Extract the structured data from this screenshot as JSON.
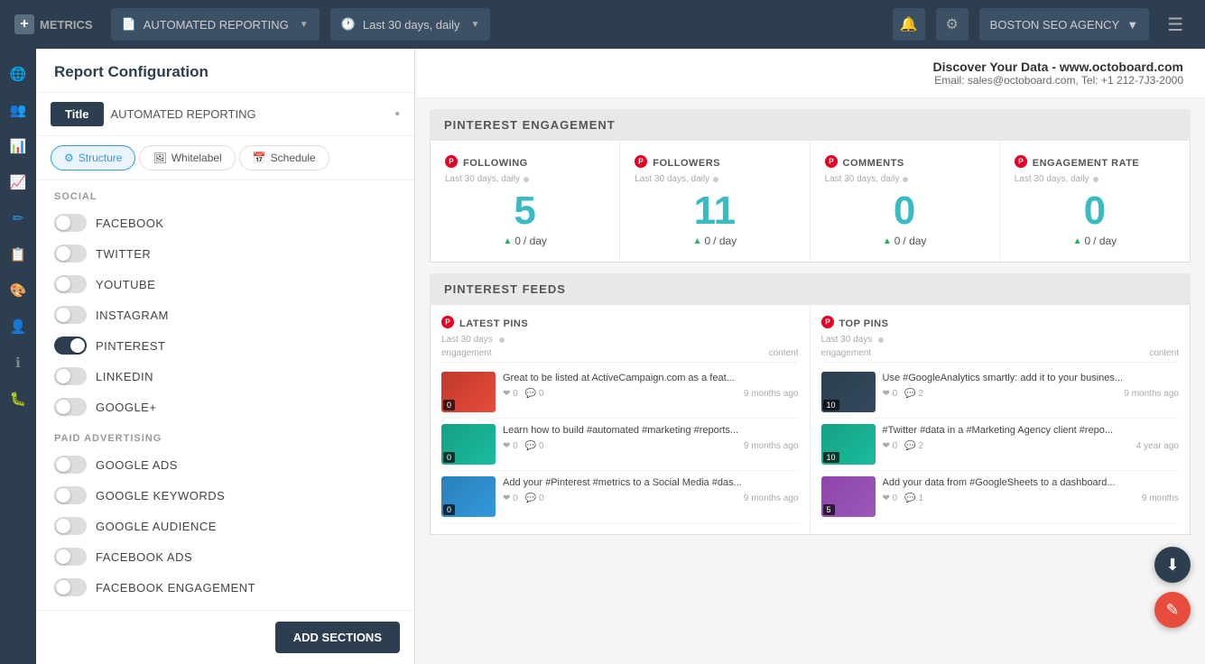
{
  "topNav": {
    "logoPlus": "+",
    "logoText": "METRICS",
    "reportingLabel": "AUTOMATED REPORTING",
    "dateRange": "Last 30 days, daily",
    "agency": "BOSTON SEO AGENCY",
    "icons": {
      "notifications": "🔔",
      "settings": "⚙",
      "arrow": "▼",
      "hamburger": "☰"
    }
  },
  "sideIcons": [
    {
      "name": "globe-icon",
      "symbol": "🌐",
      "active": true
    },
    {
      "name": "users-icon",
      "symbol": "👥",
      "active": false
    },
    {
      "name": "analytics-icon",
      "symbol": "📊",
      "active": false
    },
    {
      "name": "trending-icon",
      "symbol": "📈",
      "active": false
    },
    {
      "name": "edit-icon",
      "symbol": "✏",
      "active": true
    },
    {
      "name": "clipboard-icon",
      "symbol": "📋",
      "active": false
    },
    {
      "name": "paint-icon",
      "symbol": "🎨",
      "active": false
    },
    {
      "name": "user-icon",
      "symbol": "👤",
      "active": false
    },
    {
      "name": "info-icon",
      "symbol": "ℹ",
      "active": false
    },
    {
      "name": "bug-icon",
      "symbol": "🐛",
      "active": false
    }
  ],
  "configPanel": {
    "heading": "Report Configuration",
    "titleLabel": "Title",
    "titleValue": "AUTOMATED REPORTING",
    "tabs": [
      {
        "label": "Structure",
        "icon": "⚙",
        "active": true
      },
      {
        "label": "Whitelabel",
        "icon": "🖼",
        "active": false
      },
      {
        "label": "Schedule",
        "icon": "📅",
        "active": false
      }
    ],
    "social": {
      "sectionLabel": "SOCIAL",
      "items": [
        {
          "label": "FACEBOOK",
          "on": false
        },
        {
          "label": "TWITTER",
          "on": false
        },
        {
          "label": "YOUTUBE",
          "on": false
        },
        {
          "label": "INSTAGRAM",
          "on": false
        },
        {
          "label": "PINTEREST",
          "on": true
        },
        {
          "label": "LINKEDIN",
          "on": false
        },
        {
          "label": "GOOGLE+",
          "on": false
        }
      ]
    },
    "paidAdvertising": {
      "sectionLabel": "PAID ADVERTISING",
      "items": [
        {
          "label": "GOOGLE ADS",
          "on": false
        },
        {
          "label": "GOOGLE KEYWORDS",
          "on": false
        },
        {
          "label": "GOOGLE AUDIENCE",
          "on": false
        },
        {
          "label": "FACEBOOK ADS",
          "on": false
        },
        {
          "label": "FACEBOOK ENGAGEMENT",
          "on": false
        }
      ]
    },
    "addSectionsBtn": "ADD SECTIONS"
  },
  "reportHeader": {
    "title": "Discover Your Data - www.octoboard.com",
    "contact": "Email: sales@octoboard.com, Tel: +1 212-7J3-2000"
  },
  "pinterestEngagement": {
    "sectionTitle": "PINTEREST ENGAGEMENT",
    "cards": [
      {
        "name": "FOLLOWING",
        "period": "Last 30 days, daily",
        "value": "5",
        "trend": "0",
        "trendUnit": "/ day"
      },
      {
        "name": "FOLLOWERS",
        "period": "Last 30 days, daily",
        "value": "11",
        "trend": "0",
        "trendUnit": "/ day"
      },
      {
        "name": "COMMENTS",
        "period": "Last 30 days, daily",
        "value": "0",
        "trend": "0",
        "trendUnit": "/ day"
      },
      {
        "name": "ENGAGEMENT RATE",
        "period": "Last 30 days, daily",
        "value": "0",
        "trend": "0",
        "trendUnit": "/ day"
      }
    ]
  },
  "pinterestFeeds": {
    "sectionTitle": "PINTEREST FEEDS",
    "latestPins": {
      "title": "LATEST PINS",
      "period": "Last 30 days",
      "engagementLabel": "engagement",
      "contentLabel": "content",
      "items": [
        {
          "text": "Great to be listed at ActiveCampaign.com as a feat...",
          "likes": "0",
          "comments": "0",
          "date": "9 months ago",
          "badge": "0",
          "thumbClass": "thumb-red"
        },
        {
          "text": "Learn how to build #automated #marketing #reports...",
          "likes": "0",
          "comments": "0",
          "date": "9 months ago",
          "badge": "0",
          "thumbClass": "thumb-teal"
        },
        {
          "text": "Add your #Pinterest #metrics to a Social Media #das...",
          "likes": "0",
          "comments": "0",
          "date": "9 months ago",
          "badge": "0",
          "thumbClass": "thumb-blue"
        }
      ]
    },
    "topPins": {
      "title": "TOP PINS",
      "period": "Last 30 days",
      "engagementLabel": "engagement",
      "contentLabel": "content",
      "items": [
        {
          "text": "Use #GoogleAnalytics smartly: add it to your busines...",
          "likes": "0",
          "comments": "2",
          "date": "9 months ago",
          "badge": "10",
          "thumbClass": "thumb-dark"
        },
        {
          "text": "#Twitter #data in a #Marketing Agency client #repo...",
          "likes": "0",
          "comments": "2",
          "date": "4 year ago",
          "badge": "10",
          "thumbClass": "thumb-teal"
        },
        {
          "text": "Add your data from #GoogleSheets to a dashboard...",
          "likes": "0",
          "comments": "1",
          "date": "9 months",
          "badge": "5",
          "thumbClass": "thumb-chart"
        }
      ]
    }
  },
  "fab": {
    "downloadIcon": "⬇",
    "editIcon": "✎"
  }
}
